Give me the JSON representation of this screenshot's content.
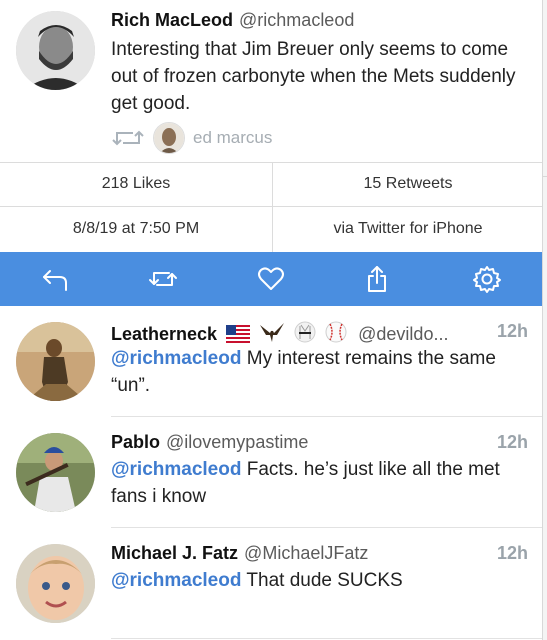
{
  "tweet": {
    "author_name": "Rich MacLeod",
    "author_handle": "@richmacleod",
    "text": "Interesting that Jim Breuer only seems to come out of frozen carbonyte when the Mets suddenly get good.",
    "retweeted_by": "ed marcus",
    "likes": "218 Likes",
    "retweets": "15 Retweets",
    "timestamp": "8/8/19 at 7:50 PM",
    "source": "via Twitter for iPhone"
  },
  "toolbar": {
    "buttons": [
      "reply-icon",
      "retweet-icon",
      "heart-icon",
      "share-icon",
      "gear-icon"
    ]
  },
  "replies": [
    {
      "name": "Leatherneck",
      "emojis": [
        "us-flag",
        "eagle",
        "karate-gi",
        "baseball"
      ],
      "handle": "@devildo...",
      "time": "12h",
      "mention": "@richmacleod",
      "text": " My interest remains the same “un”."
    },
    {
      "name": "Pablo",
      "handle": "@ilovemypastime",
      "time": "12h",
      "mention": "@richmacleod",
      "text": " Facts. he’s just like all the met fans i know"
    },
    {
      "name": "Michael J. Fatz",
      "handle": "@MichaelJFatz",
      "time": "12h",
      "mention": "@richmacleod",
      "text": " That dude SUCKS"
    }
  ],
  "colors": {
    "toolbar": "#4a8ee0",
    "mention": "#3f7ccf",
    "muted": "#9aa3aa"
  }
}
